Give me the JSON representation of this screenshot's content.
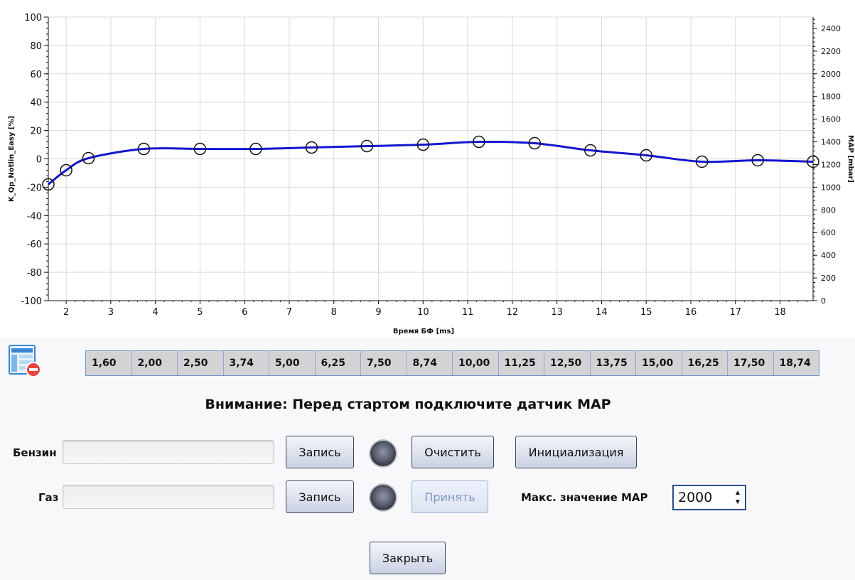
{
  "chart_data": {
    "type": "line",
    "xlabel": "Время БФ [ms]",
    "ylabel": "K_Qp_Notlin_Easy [%]",
    "y2label": "MAP [mbar]",
    "xlim": [
      1.6,
      18.74
    ],
    "ylim": [
      -100,
      100
    ],
    "y2lim": [
      0,
      2500
    ],
    "x_ticks": [
      "2",
      "3",
      "4",
      "5",
      "6",
      "7",
      "8",
      "9",
      "10",
      "11",
      "12",
      "13",
      "14",
      "15",
      "16",
      "17",
      "18"
    ],
    "y_ticks": [
      "100",
      "80",
      "60",
      "40",
      "20",
      "0",
      "-20",
      "-40",
      "-60",
      "-80",
      "-100"
    ],
    "y2_ticks": [
      "2400",
      "2200",
      "2000",
      "1800",
      "1600",
      "1400",
      "1200",
      "1000",
      "800",
      "600",
      "400",
      "200",
      "0"
    ],
    "grid": true,
    "series": [
      {
        "color": "#1515d0",
        "x": [
          1.6,
          2.0,
          2.5,
          3.74,
          5.0,
          6.25,
          7.5,
          8.74,
          10.0,
          11.25,
          12.5,
          13.75,
          15.0,
          16.25,
          17.5,
          18.74
        ],
        "y": [
          -18,
          -8,
          0.5,
          7,
          7,
          7,
          8,
          9,
          10,
          12,
          11,
          6,
          2.5,
          -2,
          -1,
          -2
        ]
      }
    ]
  },
  "x_table": [
    "1,60",
    "2,00",
    "2,50",
    "3,74",
    "5,00",
    "6,25",
    "7,50",
    "8,74",
    "10,00",
    "11,25",
    "12,50",
    "13,75",
    "15,00",
    "16,25",
    "17,50",
    "18,74"
  ],
  "warning_text": "Внимание: Перед стартом подключите датчик MAP",
  "petrol": {
    "label": "Бензин",
    "record_label": "Запись"
  },
  "gas": {
    "label": "Газ",
    "record_label": "Запись"
  },
  "buttons": {
    "clear": "Очистить",
    "init": "Инициализация",
    "accept": "Принять",
    "close": "Закрыть"
  },
  "map_max": {
    "label": "Макс. значение MAP",
    "value": "2000"
  },
  "icons": {
    "table": "table-remove-icon",
    "led": "indicator-led-icon"
  }
}
